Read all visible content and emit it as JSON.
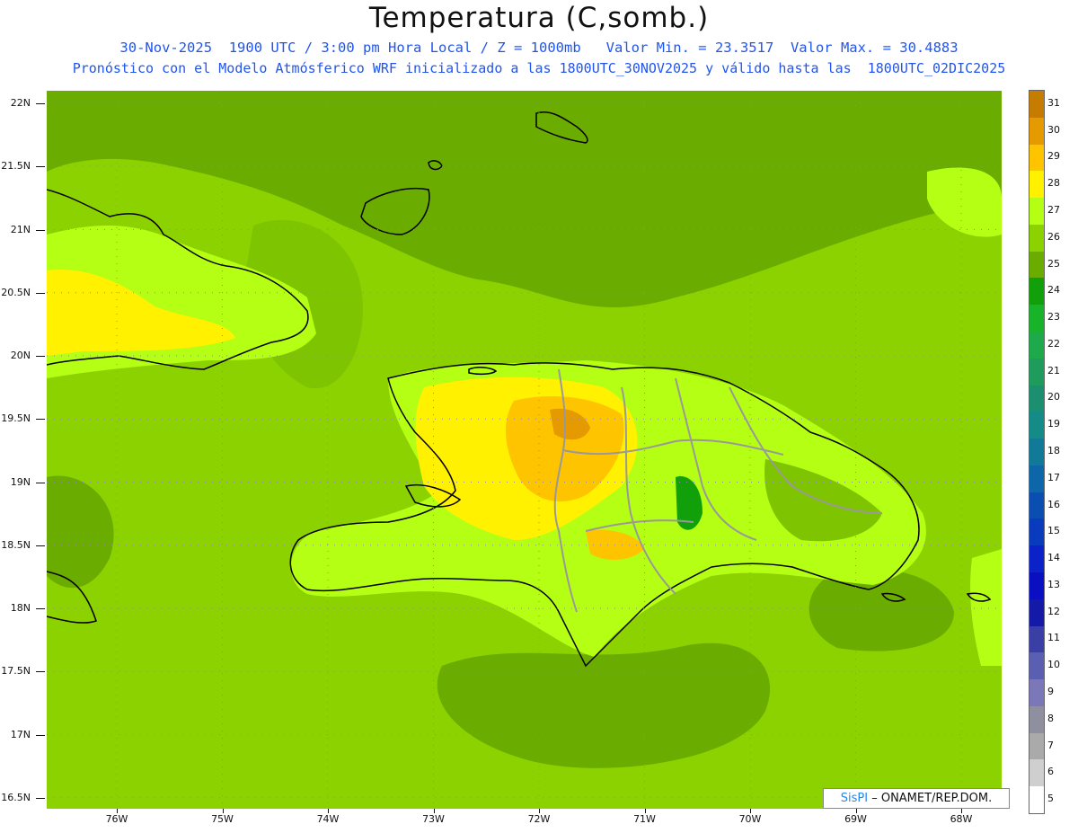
{
  "title": "Temperatura (C,somb.)",
  "subtitle_1": "30-Nov-2025  1900 UTC / 3:00 pm Hora Local / Z = 1000mb   Valor Min. = 23.3517  Valor Max. = 30.4883",
  "subtitle_2": "Pronóstico con el Modelo Atmósferico WRF inicializado a las 1800UTC_30NOV2025 y válido hasta las  1800UTC_02DIC2025",
  "map": {
    "lat_labels": [
      "22N",
      "21.5N",
      "21N",
      "20.5N",
      "20N",
      "19.5N",
      "19N",
      "18.5N",
      "18N",
      "17.5N",
      "17N",
      "16.5N"
    ],
    "lon_labels": [
      "76W",
      "75W",
      "74W",
      "73W",
      "72W",
      "71W",
      "70W",
      "69W",
      "68W"
    ],
    "lat_values": [
      22,
      21.5,
      21,
      20.5,
      20,
      19.5,
      19,
      18.5,
      18,
      17.5,
      17,
      16.5
    ],
    "lon_values": [
      -76,
      -75,
      -74,
      -73,
      -72,
      -71,
      -70,
      -69,
      -68
    ],
    "min_value": 23.3517,
    "max_value": 30.4883,
    "credit_brand": "SisPI",
    "credit_text": "– ONAMET/REP.DOM."
  },
  "colorbar": {
    "labels": [
      "31",
      "30",
      "29",
      "28",
      "27",
      "26",
      "25",
      "24",
      "23",
      "22",
      "21",
      "20",
      "19",
      "18",
      "17",
      "16",
      "15",
      "14",
      "13",
      "12",
      "11",
      "10",
      "9",
      "8",
      "7",
      "6",
      "5"
    ],
    "colors": [
      "#c67c00",
      "#e49a00",
      "#ffc400",
      "#fff100",
      "#b4ff14",
      "#8cd100",
      "#6aac00",
      "#12a00a",
      "#17b42a",
      "#1ea94a",
      "#1f9b5c",
      "#1b8f70",
      "#158b88",
      "#107a98",
      "#0d66a8",
      "#0b4eb2",
      "#0a3bbd",
      "#0a22c8",
      "#0b0fc2",
      "#1419a8",
      "#3a3fa6",
      "#5a5fb2",
      "#7c77b8",
      "#8f8f9f",
      "#aaaaaa",
      "#cfcfcf",
      "#ffffff"
    ]
  }
}
